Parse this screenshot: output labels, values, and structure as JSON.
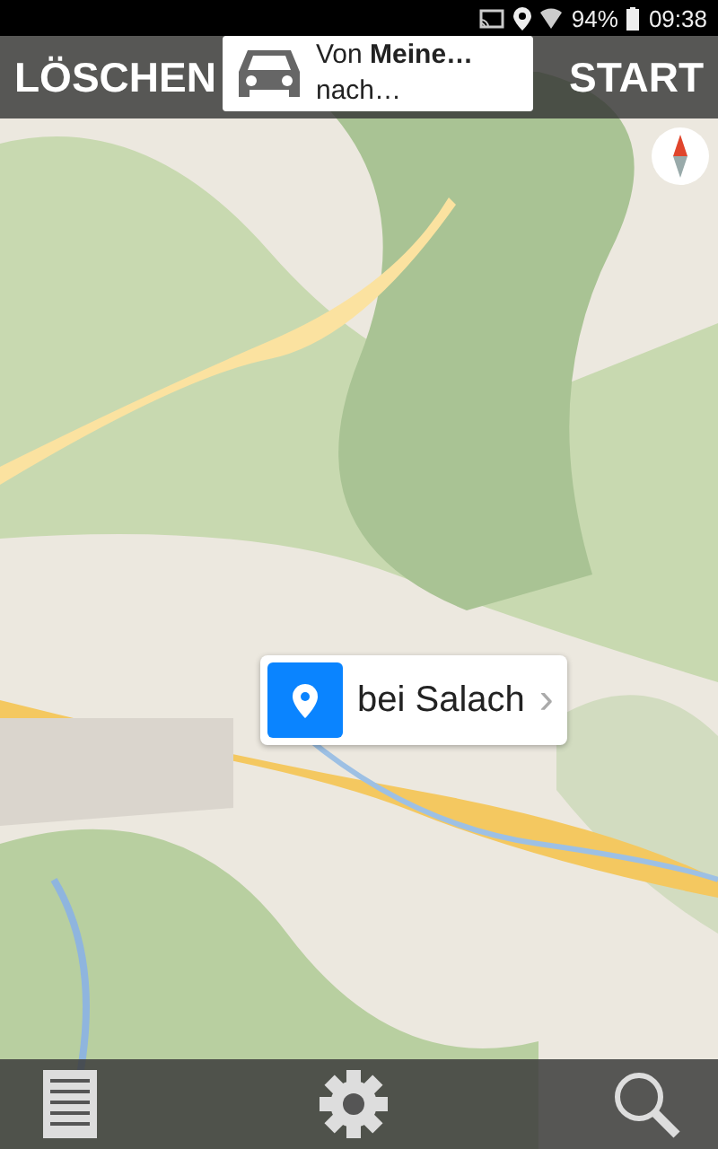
{
  "status_bar": {
    "battery": "94%",
    "time": "09:38"
  },
  "top_bar": {
    "left_button": "LÖSCHEN",
    "route": {
      "from": "Von **Meine…**",
      "to": "nach…"
    },
    "right_button": "START"
  },
  "map": {
    "kind": "picture",
    "popup": {
      "label": "bei Salach",
      "chevron": "›"
    }
  },
  "bottom_bar": {
    "buttons": [
      {
        "kind": "list"
      },
      {
        "kind": "settings"
      },
      {
        "kind": "search"
      }
    ]
  }
}
